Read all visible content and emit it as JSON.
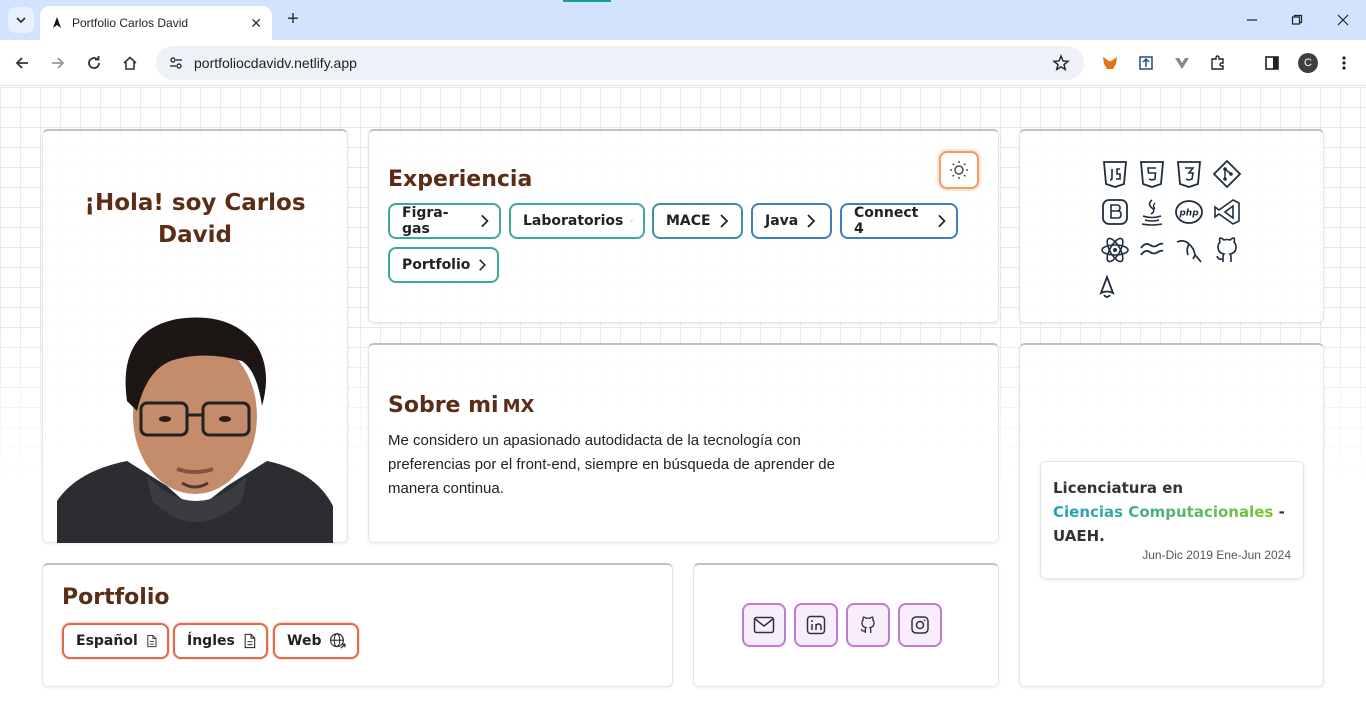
{
  "browser": {
    "tab_title": "Portfolio Carlos David",
    "url": "portfoliocdavidv.netlify.app",
    "profile_initial": "C"
  },
  "intro": {
    "greeting_line1": "¡Hola! soy Carlos",
    "greeting_line2": "David"
  },
  "experience": {
    "title": "Experiencia",
    "chips": [
      "Figra-gas",
      "Laboratorios",
      "MACE",
      "Java",
      "Connect 4",
      "Portfolio"
    ]
  },
  "tech_stack": {
    "icons": [
      "javascript-icon",
      "html5-icon",
      "css3-icon",
      "git-icon",
      "bootstrap-icon",
      "java-icon",
      "php-icon",
      "visual-studio-icon",
      "react-icon",
      "tailwind-icon",
      "mysql-icon",
      "github-icon",
      "astro-icon"
    ]
  },
  "about": {
    "title": "Sobre mi",
    "flag": "MX",
    "text": "Me considero un apasionado autodidacta de la tecnología con preferencias por el front-end, siempre en búsqueda de aprender de manera continua."
  },
  "education": {
    "line1": "Licenciatura en",
    "highlight": "Ciencias Computacionales",
    "separator": " -",
    "line3": "UAEH.",
    "dates": "Jun-Dic 2019 Ene-Jun 2024"
  },
  "portfolio": {
    "title": "Portfolio",
    "buttons": [
      "Español",
      "Íngles",
      "Web"
    ]
  },
  "social": [
    "mail-icon",
    "linkedin-icon",
    "github-icon",
    "instagram-icon"
  ],
  "colors": {
    "heading": "#5a2d16",
    "theme_button_border": "#f39a66",
    "portfolio_chip_border": "#e06a4a",
    "social_border": "#c27ad4",
    "tab_bar": "#d3e3fd"
  }
}
